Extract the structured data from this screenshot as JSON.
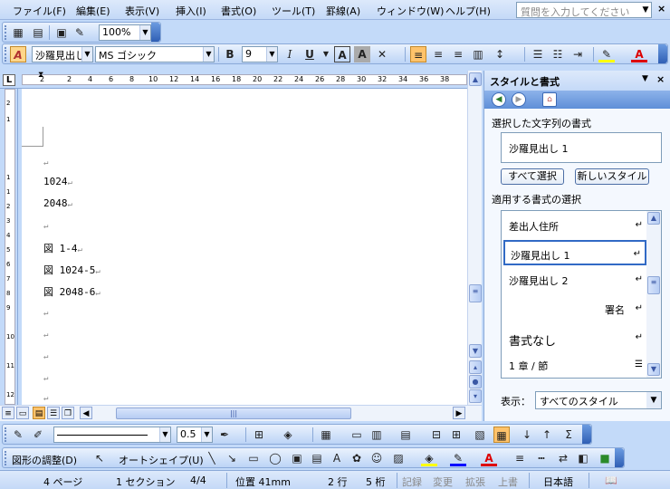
{
  "menu": {
    "items": [
      "ファイル(F)",
      "編集(E)",
      "表示(V)",
      "挿入(I)",
      "書式(O)",
      "ツール(T)",
      "罫線(A)",
      "ウィンドウ(W)",
      "ヘルプ(H)"
    ],
    "help_placeholder": "質問を入力してください"
  },
  "standard_toolbar": {
    "zoom": "100%"
  },
  "format_toolbar": {
    "style": "沙羅見出し",
    "font": "MS ゴシック",
    "size": "9",
    "bold": "B",
    "italic": "I",
    "underline": "U"
  },
  "ruler": {
    "h_ticks": [
      "2",
      "2",
      "4",
      "6",
      "8",
      "10",
      "12",
      "14",
      "16",
      "18",
      "20",
      "22",
      "24",
      "26",
      "28",
      "30",
      "32",
      "34",
      "36",
      "38"
    ],
    "v_ticks": [
      "2",
      "1",
      "1",
      "1",
      "2",
      "3",
      "4",
      "5",
      "6",
      "7",
      "8",
      "9",
      "10",
      "11",
      "12"
    ]
  },
  "document": {
    "lines": [
      "",
      "1024",
      "2048",
      "",
      "図 1-4",
      "図 1024-5",
      "図 2048-6",
      "",
      "",
      "",
      "",
      ""
    ],
    "para_mark": "↵"
  },
  "pane": {
    "title": "スタイルと書式",
    "selected_label": "選択した文字列の書式",
    "selected_value": "沙羅見出し 1",
    "select_all": "すべて選択",
    "new_style": "新しいスタイル",
    "apply_label": "適用する書式の選択",
    "styles": [
      "差出人住所",
      "沙羅見出し 1",
      "沙羅見出し 2",
      "署名",
      "書式なし",
      "1 章 / 節"
    ],
    "show_label": "表示：",
    "show_value": "すべてのスタイル"
  },
  "drawing_toolbar": {
    "line_width": "0.5"
  },
  "draw_toolbar": {
    "adjust": "図形の調整(D)",
    "autoshape": "オートシェイプ(U)"
  },
  "status": {
    "page": "4 ページ",
    "section": "1 セクション",
    "pages": "4/4",
    "position": "位置 41mm",
    "line": "2 行",
    "column": "5 桁",
    "rec": "記録",
    "trk": "変更",
    "ext": "拡張",
    "ovr": "上書",
    "lang": "日本語"
  },
  "colors": {
    "accent": "#316ac5",
    "bar": "#c4d9f7"
  }
}
